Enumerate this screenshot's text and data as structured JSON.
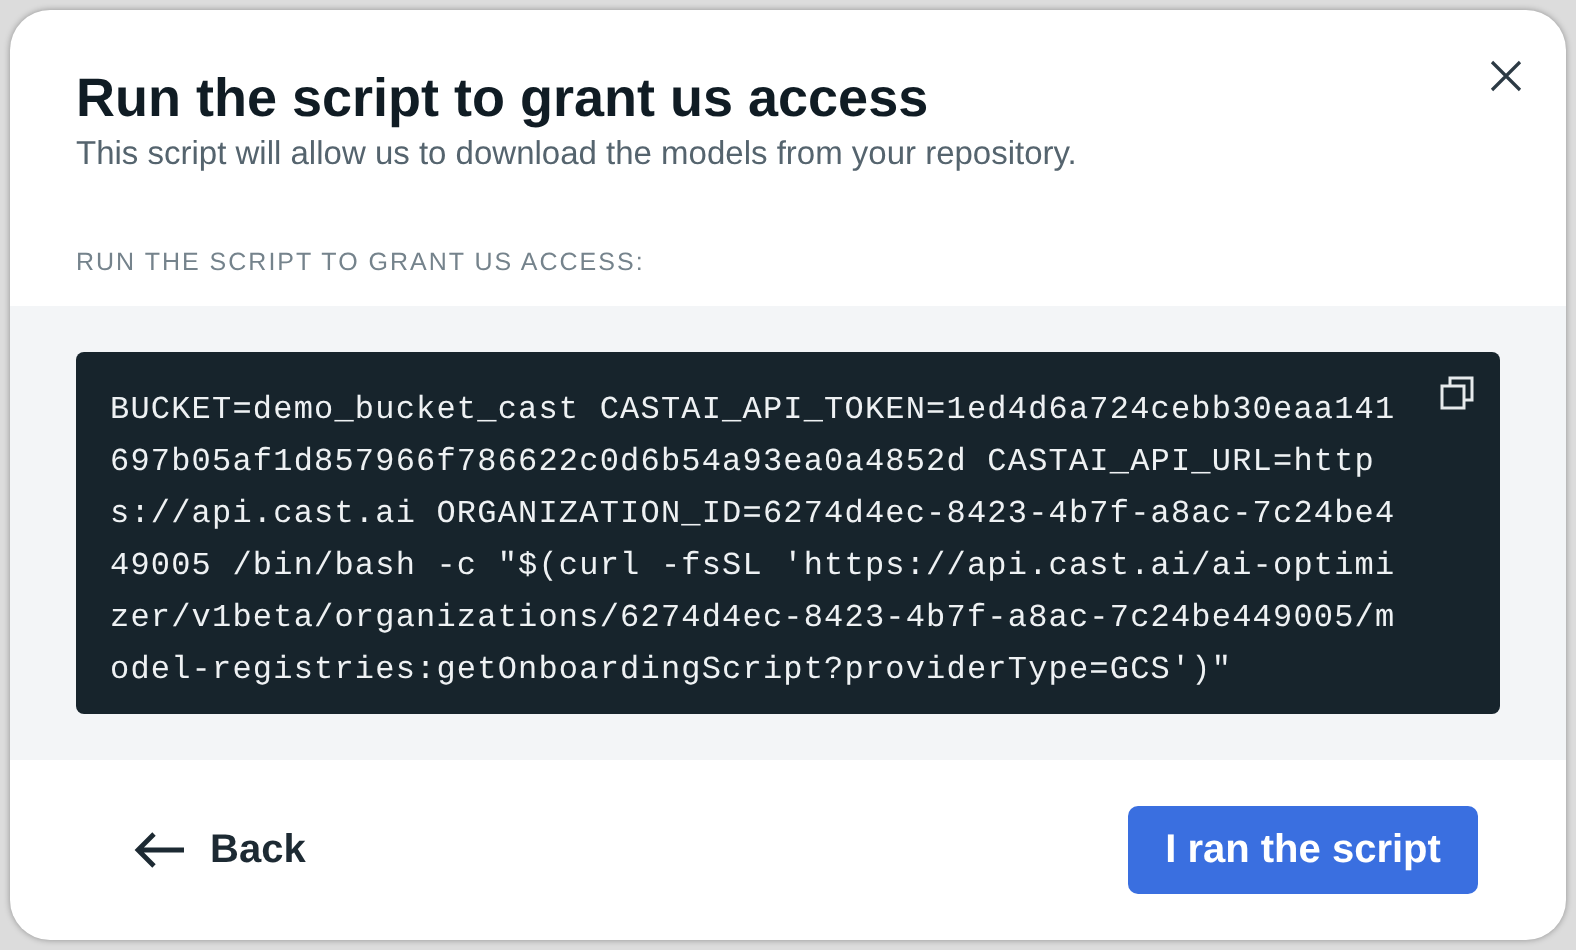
{
  "dialog": {
    "title": "Run the script to grant us access",
    "subtitle": "This script will allow us to download the models from your repository."
  },
  "script_section": {
    "label": "RUN THE SCRIPT TO GRANT US ACCESS:",
    "code": "BUCKET=demo_bucket_cast CASTAI_API_TOKEN=1ed4d6a724cebb30eaa141697b05af1d857966f786622c0d6b54a93ea0a4852d CASTAI_API_URL=https://api.cast.ai ORGANIZATION_ID=6274d4ec-8423-4b7f-a8ac-7c24be449005 /bin/bash -c \"$(curl -fsSL 'https://api.cast.ai/ai-optimizer/v1beta/organizations/6274d4ec-8423-4b7f-a8ac-7c24be449005/model-registries:getOnboardingScript?providerType=GCS')\""
  },
  "footer": {
    "back": "Back",
    "primary": "I ran the script"
  }
}
